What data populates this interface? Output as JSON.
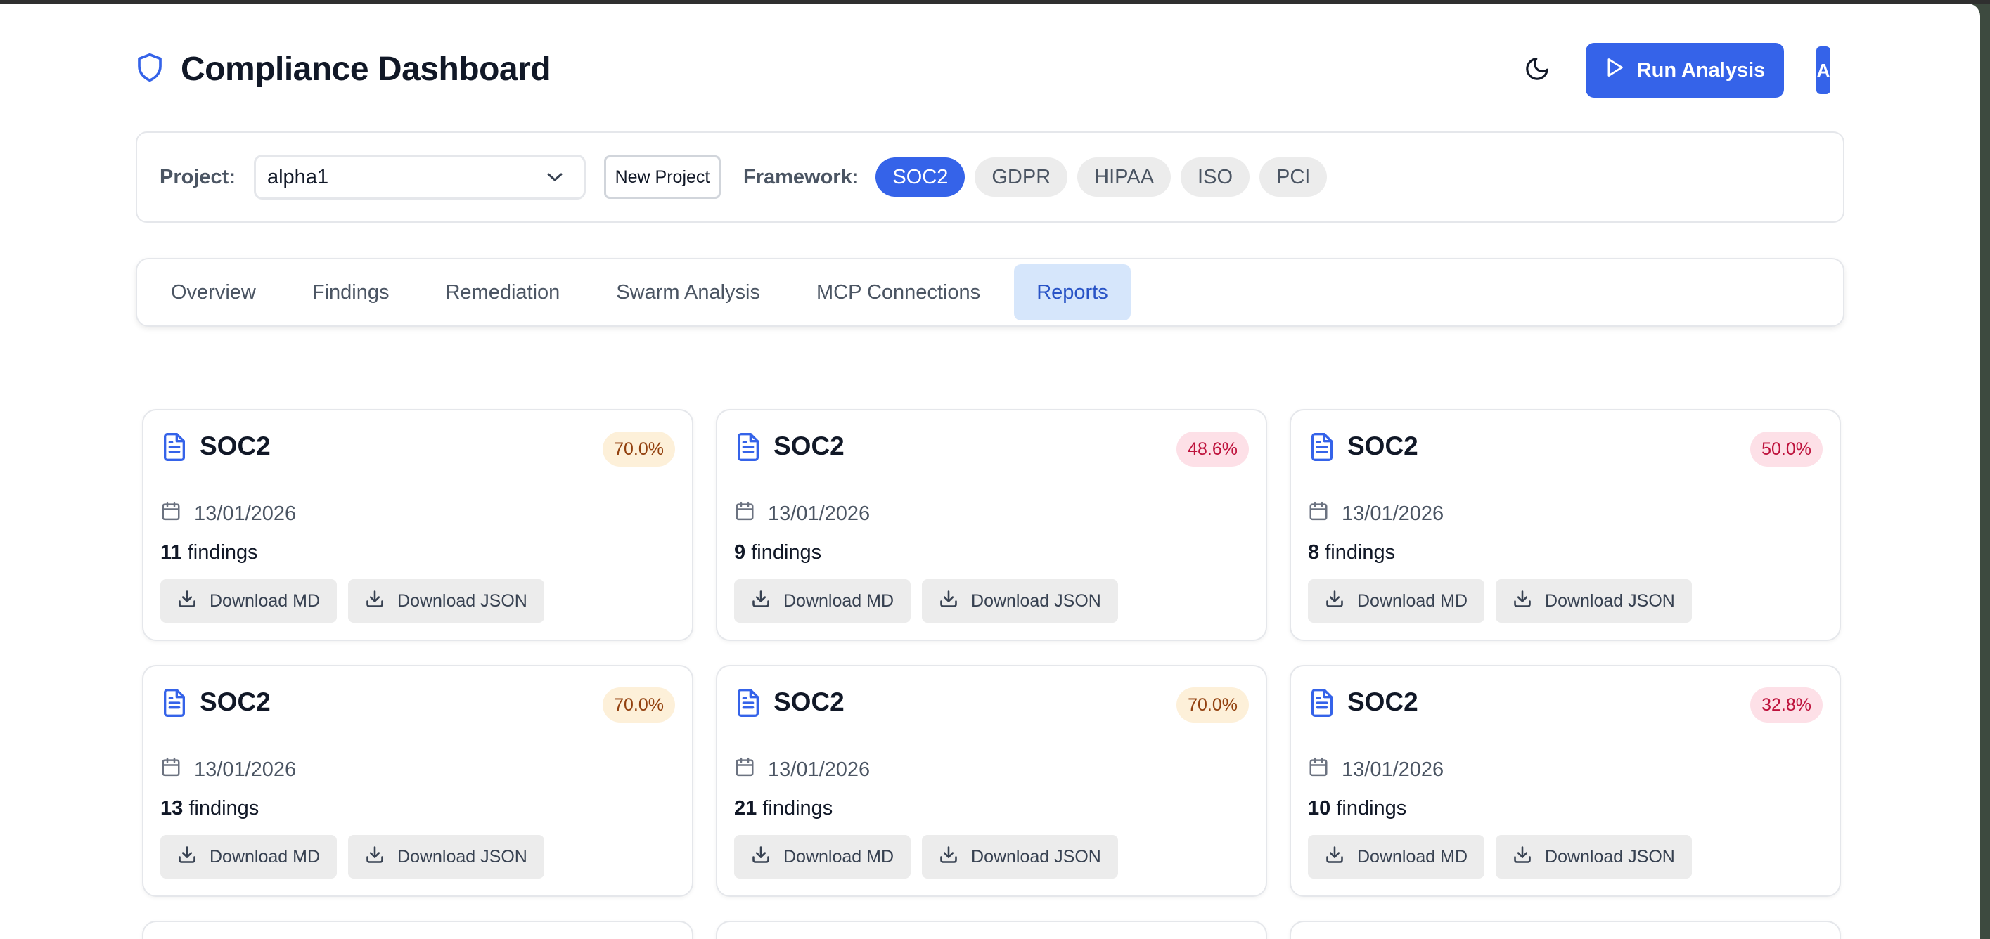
{
  "header": {
    "title": "Compliance Dashboard",
    "run_label": "Run Analysis",
    "avatar_initial": "A"
  },
  "filters": {
    "project_label": "Project:",
    "project_value": "alpha1",
    "new_project_label": "New Project",
    "framework_label": "Framework:",
    "frameworks": [
      "SOC2",
      "GDPR",
      "HIPAA",
      "ISO",
      "PCI"
    ],
    "active_framework": "SOC2"
  },
  "tabs": [
    "Overview",
    "Findings",
    "Remediation",
    "Swarm Analysis",
    "MCP Connections",
    "Reports"
  ],
  "active_tab": "Reports",
  "reports": [
    {
      "framework": "SOC2",
      "score": "70.0%",
      "status": "warn",
      "date": "13/01/2026",
      "count": "11",
      "findings_suffix": " findings",
      "md_label": "Download MD",
      "json_label": "Download JSON"
    },
    {
      "framework": "SOC2",
      "score": "48.6%",
      "status": "bad",
      "date": "13/01/2026",
      "count": "9",
      "findings_suffix": " findings",
      "md_label": "Download MD",
      "json_label": "Download JSON"
    },
    {
      "framework": "SOC2",
      "score": "50.0%",
      "status": "bad",
      "date": "13/01/2026",
      "count": "8",
      "findings_suffix": " findings",
      "md_label": "Download MD",
      "json_label": "Download JSON"
    },
    {
      "framework": "SOC2",
      "score": "70.0%",
      "status": "warn",
      "date": "13/01/2026",
      "count": "13",
      "findings_suffix": " findings",
      "md_label": "Download MD",
      "json_label": "Download JSON"
    },
    {
      "framework": "SOC2",
      "score": "70.0%",
      "status": "warn",
      "date": "13/01/2026",
      "count": "21",
      "findings_suffix": " findings",
      "md_label": "Download MD",
      "json_label": "Download JSON"
    },
    {
      "framework": "SOC2",
      "score": "32.8%",
      "status": "bad",
      "date": "13/01/2026",
      "count": "10",
      "findings_suffix": " findings",
      "md_label": "Download MD",
      "json_label": "Download JSON"
    }
  ],
  "colors": {
    "accent": "#3563e9",
    "warn_bg": "#fdf0d9",
    "bad_bg": "#fde0e7"
  },
  "icons": {
    "title": "shield-icon",
    "theme": "moon-icon",
    "run": "play-icon",
    "select": "chevron-down-icon",
    "report": "document-icon",
    "date": "calendar-icon",
    "download": "download-icon"
  }
}
